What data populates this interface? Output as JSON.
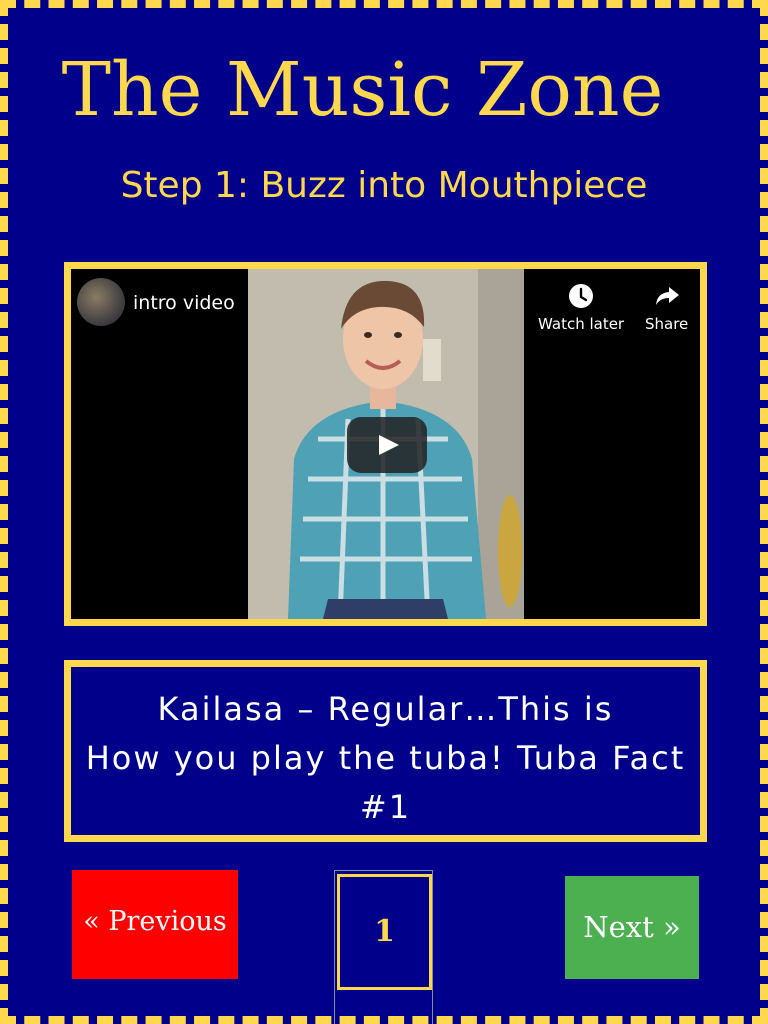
{
  "site": {
    "title": "The Music Zone",
    "subtitle": "Step 1: Buzz into Mouthpiece"
  },
  "video": {
    "title": "intro video",
    "watch_later_label": "Watch later",
    "share_label": "Share"
  },
  "caption": {
    "lines": [
      "Kailasa – Regular…This is",
      "How you play the tuba! Tuba Fact",
      "#1"
    ]
  },
  "pagination": {
    "previous_label": "« Previous",
    "current_page": "1",
    "next_label": "Next »"
  },
  "colors": {
    "background": "#00008b",
    "accent": "#ffd84d",
    "previous_button": "#ff0000",
    "next_button": "#4caf50"
  }
}
